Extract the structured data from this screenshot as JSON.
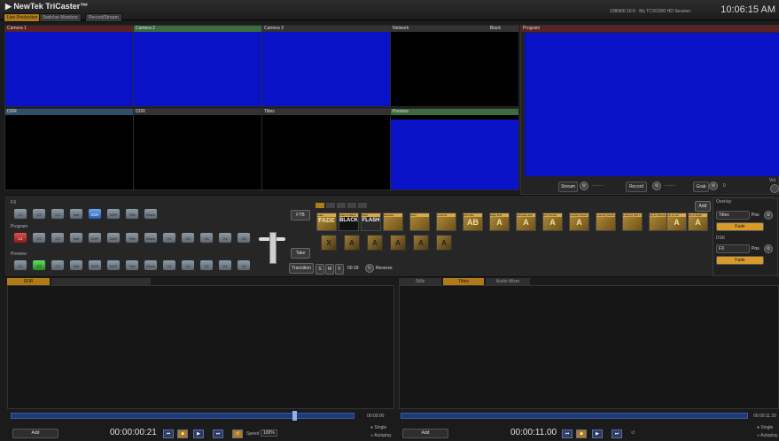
{
  "app": {
    "title": "NewTek TriCaster™",
    "resolution": "1080i60 16:9 · My TCXD300 HD Session",
    "clock": "10:06:15 AM"
  },
  "tabs": [
    {
      "label": "Live Production",
      "active": true
    },
    {
      "label": "Switcher Monitors",
      "active": false
    },
    {
      "label": "Record/Stream",
      "active": false
    }
  ],
  "monitors": [
    {
      "label": "Camera 1",
      "color": "#5a2222",
      "fill": "blue"
    },
    {
      "label": "Camera 2",
      "color": "#3d6b3d",
      "fill": "blue"
    },
    {
      "label": "Camera 3",
      "color": "#333333",
      "fill": "blue"
    },
    {
      "label": "Network",
      "extra": "Black",
      "color": "#333333",
      "fill": "black"
    },
    {
      "label": "DDR",
      "color": "#2f4f6a",
      "fill": "black"
    },
    {
      "label": "DDR",
      "color": "#333333",
      "fill": "black"
    },
    {
      "label": "Titles",
      "color": "#333333",
      "fill": "black"
    },
    {
      "label": "Preview",
      "color": "#3d6b3d",
      "fill": "blue"
    }
  ],
  "program": {
    "label": "Program",
    "controls": [
      "Stream",
      "Record",
      "Grab"
    ],
    "stream_time": "--:--:--",
    "record_time": "--:--:--",
    "grab_count": "0",
    "volume_label": "Vol"
  },
  "switcher": {
    "fx_label": "FX",
    "program_label": "Program",
    "preview_label": "Preview",
    "fx_buttons": [
      "C1",
      "C2",
      "C3",
      "Net",
      "DDR",
      "DDR",
      "Title",
      "Black"
    ],
    "program_buttons": [
      "C1",
      "C2",
      "C3",
      "Net",
      "DDR",
      "DDR",
      "Title",
      "Black",
      "V1",
      "V2",
      "V3",
      "V4",
      "V5"
    ],
    "preview_buttons": [
      "C1",
      "C2",
      "C3",
      "Net",
      "DDR",
      "DDR",
      "Title",
      "Black",
      "V1",
      "V2",
      "V3",
      "V4",
      "V5"
    ],
    "ftb": "FTB",
    "take": "Take",
    "transition": "Transition",
    "speed_buttons": [
      "S",
      "M",
      "F"
    ],
    "duration": "00:18",
    "reverse": "Reverse",
    "add": "Add",
    "transitions": [
      {
        "label": "Fade",
        "glyph": "FADE"
      },
      {
        "label": "Fade to Black",
        "glyph": "BLACK"
      },
      {
        "label": "Flash",
        "glyph": "FLASH"
      },
      {
        "label": "Dissolve",
        "glyph": ""
      },
      {
        "label": "Swirl",
        "glyph": ""
      },
      {
        "label": "Control1",
        "glyph": ""
      },
      {
        "label": "Diff Little",
        "glyph": "AB"
      },
      {
        "label": "Edge Roll",
        "glyph": "A"
      },
      {
        "label": "Diff Gate Roll",
        "glyph": "A"
      },
      {
        "label": "Diff Tumble",
        "glyph": "A"
      },
      {
        "label": "Fumble Strobe",
        "glyph": "A"
      },
      {
        "label": "Framing Strobe",
        "glyph": ""
      },
      {
        "label": "Framing Sph 1",
        "glyph": ""
      },
      {
        "label": "Fly in Arbitrary",
        "glyph": ""
      },
      {
        "label": "Fly in Left",
        "glyph": "A"
      },
      {
        "label": "Fly in Right",
        "glyph": "A"
      }
    ],
    "transitions_row2": [
      "X",
      "A",
      "A",
      "A",
      "A",
      "A"
    ],
    "overlay": {
      "label": "Overlay",
      "src": "Titles",
      "pos": "Pos",
      "fade": "Fade"
    },
    "downstream": {
      "label": "DSK",
      "src": "FX",
      "pos": "Pos",
      "fade": "Fade"
    }
  },
  "ddr": {
    "tabs_left": [
      {
        "label": "DDR",
        "active": true
      }
    ],
    "tabs_right": [
      {
        "label": "Stills",
        "active": false
      },
      {
        "label": "Titles",
        "active": true
      },
      {
        "label": "Audio Mixer",
        "active": false
      }
    ],
    "left": {
      "timecode": "00:00:00:21",
      "add": "Add",
      "speed_label": "Speed",
      "speed_value": "100%",
      "mode_single": "Single",
      "mode_autoplay": "Autoplay",
      "end_label": "00:00:00"
    },
    "right": {
      "timecode": "00:00:11.00",
      "add": "Add",
      "end_time": "00:00:11.20",
      "mode_single": "Single",
      "mode_autoplay": "Autoplay"
    }
  }
}
